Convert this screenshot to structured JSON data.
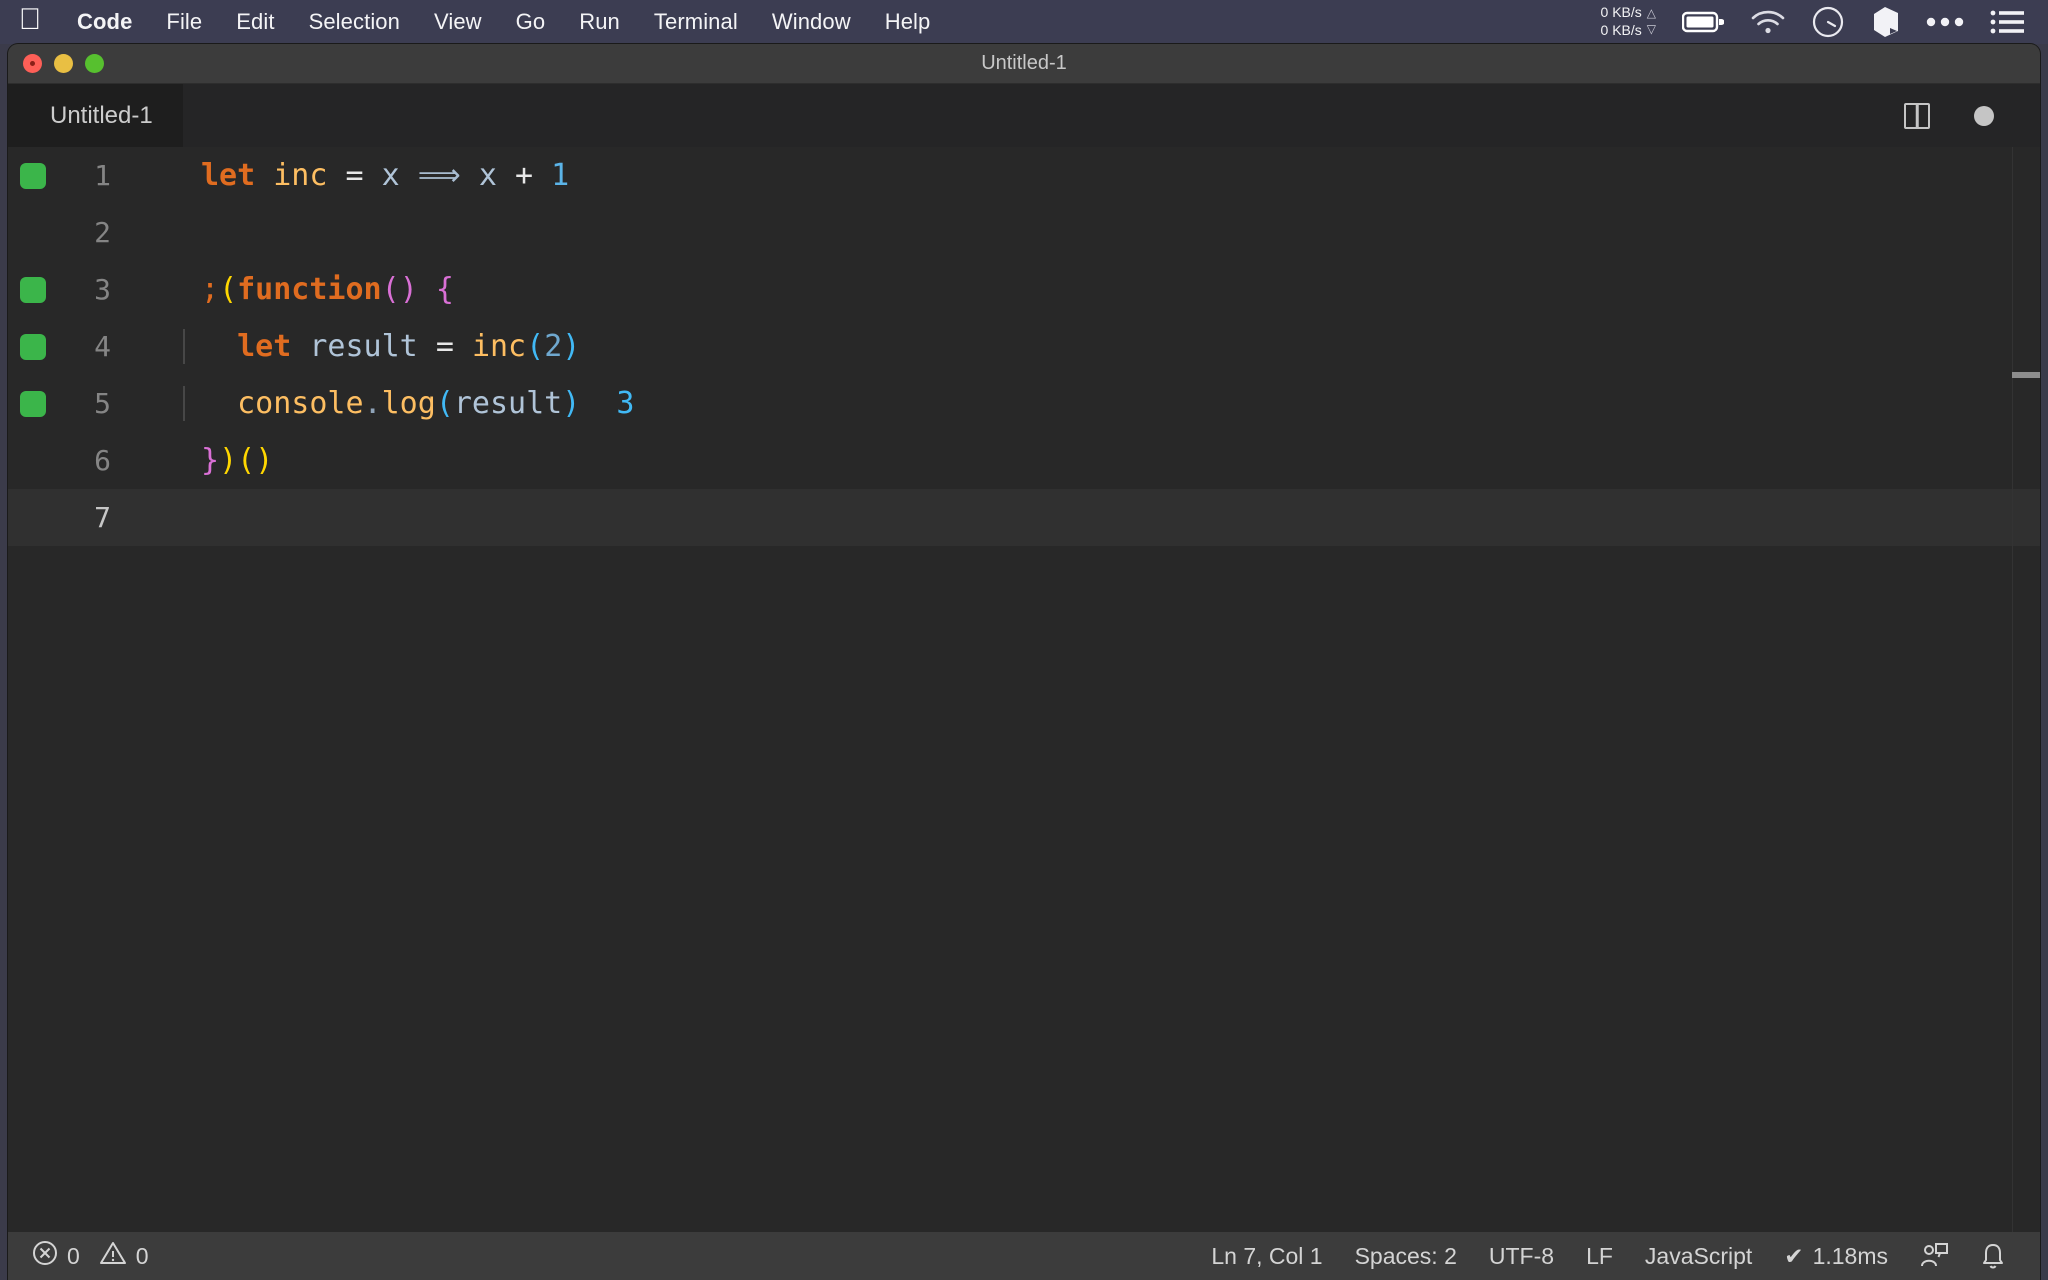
{
  "menubar": {
    "apple_icon": "apple-logo-icon",
    "items": [
      {
        "label": "Code",
        "bold": true
      },
      {
        "label": "File",
        "bold": false
      },
      {
        "label": "Edit",
        "bold": false
      },
      {
        "label": "Selection",
        "bold": false
      },
      {
        "label": "View",
        "bold": false
      },
      {
        "label": "Go",
        "bold": false
      },
      {
        "label": "Run",
        "bold": false
      },
      {
        "label": "Terminal",
        "bold": false
      },
      {
        "label": "Window",
        "bold": false
      },
      {
        "label": "Help",
        "bold": false
      }
    ],
    "network": {
      "upload": "0 KB/s",
      "download": "0 KB/s",
      "up_arrow": "triangle-up-icon",
      "down_arrow": "triangle-down-icon"
    },
    "status_icons": [
      "battery-icon",
      "wifi-icon",
      "speedometer-icon",
      "cube-icon",
      "ellipsis-icon",
      "list-menu-icon"
    ]
  },
  "window": {
    "title": "Untitled-1",
    "traffic_lights": [
      "close-button",
      "minimize-button",
      "maximize-button"
    ]
  },
  "tabs": {
    "active_tab": "Untitled-1",
    "actions": [
      "split-editor-icon",
      "unsaved-indicator-dot"
    ]
  },
  "editor": {
    "language": "JavaScript",
    "cursor_line": 7,
    "lines": [
      {
        "number": "1",
        "breakpoint": true,
        "active": false,
        "indent_guide": false,
        "tokens": [
          {
            "t": "let",
            "c": "kw"
          },
          {
            "t": " ",
            "c": "op"
          },
          {
            "t": "inc",
            "c": "fn"
          },
          {
            "t": " ",
            "c": "op"
          },
          {
            "t": "=",
            "c": "op"
          },
          {
            "t": " ",
            "c": "op"
          },
          {
            "t": "x",
            "c": "var"
          },
          {
            "t": " ",
            "c": "op"
          },
          {
            "t": "⟹",
            "c": "arrow"
          },
          {
            "t": " ",
            "c": "op"
          },
          {
            "t": "x",
            "c": "var"
          },
          {
            "t": " ",
            "c": "op"
          },
          {
            "t": "+",
            "c": "op"
          },
          {
            "t": " ",
            "c": "op"
          },
          {
            "t": "1",
            "c": "num"
          }
        ]
      },
      {
        "number": "2",
        "breakpoint": false,
        "active": false,
        "indent_guide": false,
        "tokens": []
      },
      {
        "number": "3",
        "breakpoint": true,
        "active": false,
        "indent_guide": false,
        "tokens": [
          {
            "t": ";",
            "c": "punc"
          },
          {
            "t": "(",
            "c": "br1"
          },
          {
            "t": "function",
            "c": "fnb"
          },
          {
            "t": "(",
            "c": "br2"
          },
          {
            "t": ")",
            "c": "br2"
          },
          {
            "t": " ",
            "c": "op"
          },
          {
            "t": "{",
            "c": "br2"
          }
        ]
      },
      {
        "number": "4",
        "breakpoint": true,
        "active": false,
        "indent_guide": true,
        "tokens": [
          {
            "t": "  ",
            "c": "op"
          },
          {
            "t": "let",
            "c": "kw"
          },
          {
            "t": " ",
            "c": "op"
          },
          {
            "t": "result",
            "c": "var"
          },
          {
            "t": " ",
            "c": "op"
          },
          {
            "t": "=",
            "c": "op"
          },
          {
            "t": " ",
            "c": "op"
          },
          {
            "t": "inc",
            "c": "fn"
          },
          {
            "t": "(",
            "c": "br3"
          },
          {
            "t": "2",
            "c": "num2"
          },
          {
            "t": ")",
            "c": "br3"
          }
        ]
      },
      {
        "number": "5",
        "breakpoint": true,
        "active": false,
        "indent_guide": true,
        "inline_value": "3",
        "tokens": [
          {
            "t": "  ",
            "c": "op"
          },
          {
            "t": "console",
            "c": "fn"
          },
          {
            "t": ".",
            "c": "dot"
          },
          {
            "t": "log",
            "c": "fn"
          },
          {
            "t": "(",
            "c": "br3"
          },
          {
            "t": "result",
            "c": "var"
          },
          {
            "t": ")",
            "c": "br3"
          }
        ]
      },
      {
        "number": "6",
        "breakpoint": false,
        "active": false,
        "indent_guide": false,
        "tokens": [
          {
            "t": "}",
            "c": "br2"
          },
          {
            "t": ")",
            "c": "br1"
          },
          {
            "t": "(",
            "c": "br1"
          },
          {
            "t": ")",
            "c": "br1"
          }
        ]
      },
      {
        "number": "7",
        "breakpoint": false,
        "active": true,
        "indent_guide": false,
        "tokens": []
      }
    ]
  },
  "statusbar": {
    "errors_icon": "error-circle-icon",
    "errors": "0",
    "warnings_icon": "warning-triangle-icon",
    "warnings": "0",
    "position": "Ln 7, Col 1",
    "indentation": "Spaces: 2",
    "encoding": "UTF-8",
    "eol": "LF",
    "language": "JavaScript",
    "runtime_check": "✔",
    "runtime": "1.18ms",
    "feedback_icon": "feedback-person-icon",
    "notifications_icon": "bell-icon"
  },
  "colors": {
    "menubar_bg": "#3c3d52",
    "titlebar_bg": "#3c3c3c",
    "editor_bg": "#282828",
    "tabstrip_bg": "#252526",
    "active_tab_bg": "#1e1e1e",
    "statusbar_bg": "#3c3c3c",
    "breakpoint_green": "#3bb54a",
    "active_line_bg": "#303030"
  }
}
